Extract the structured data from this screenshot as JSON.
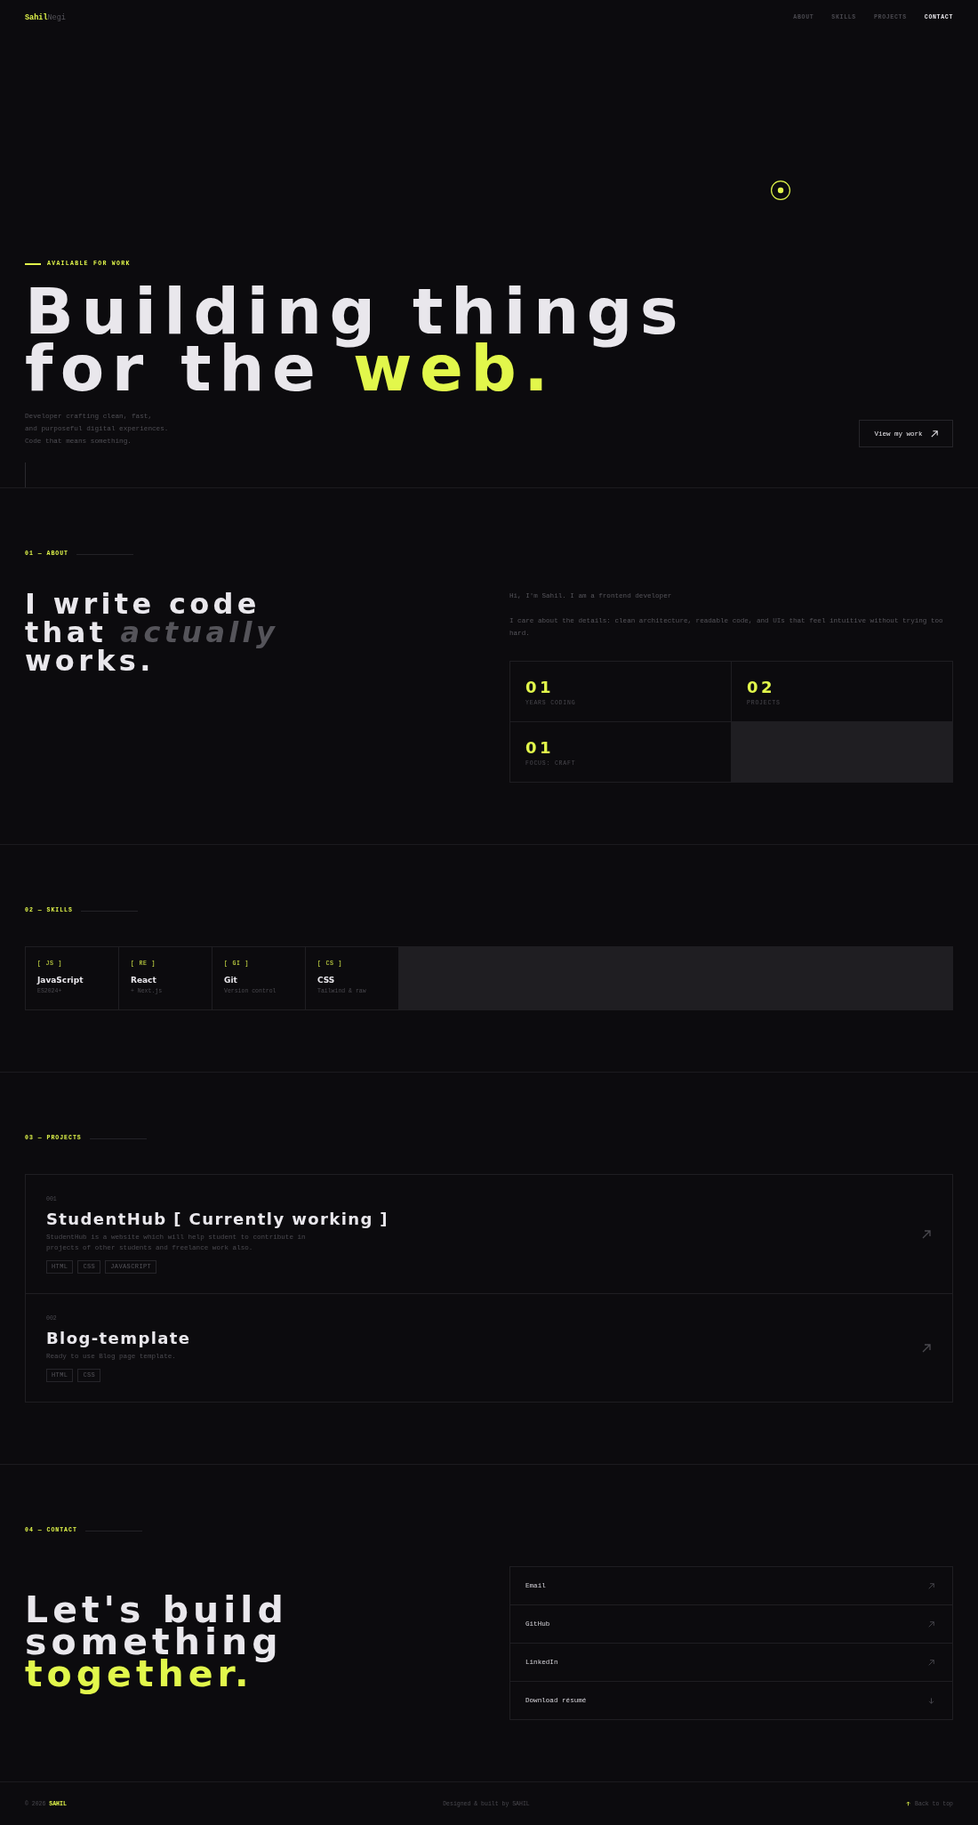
{
  "nav": {
    "logo": "**Sahil**Negi",
    "links": [
      {
        "label": "ABOUT",
        "selected": false
      },
      {
        "label": "SKILLS",
        "selected": false
      },
      {
        "label": "PROJECTS",
        "selected": false
      },
      {
        "label": "CONTACT",
        "selected": true
      }
    ]
  },
  "hero": {
    "status": "AVAILABLE FOR WORK",
    "title": "Building things\nfor the **web.**",
    "intro": "Developer crafting clean, fast,\nand purposeful digital experiences.\nCode that means something.",
    "cta": "View my work"
  },
  "about": {
    "section_label": "01 — ABOUT",
    "title": "I write code\nthat *actually*\nworks.",
    "paragraphs": [
      "Hi, I'm Sahil. I am a frontend developer",
      "I care about the details: clean architecture, readable code, and UIs that feel intuitive without trying too hard."
    ],
    "stats": [
      {
        "value": "01",
        "label": "YEARS CODING"
      },
      {
        "value": "02",
        "label": "PROJECTS"
      },
      {
        "value": "01",
        "label": "FOCUS: CRAFT"
      }
    ]
  },
  "skills": {
    "section_label": "02 — SKILLS",
    "items": [
      {
        "code": "[ JS ]",
        "name": "JavaScript",
        "detail": "ES2024+"
      },
      {
        "code": "[ RE ]",
        "name": "React",
        "detail": "+ Next.js"
      },
      {
        "code": "[ GI ]",
        "name": "Git",
        "detail": "Version control"
      },
      {
        "code": "[ CS ]",
        "name": "CSS",
        "detail": "Tailwind & raw"
      }
    ]
  },
  "projects": {
    "section_label": "03 — PROJECTS",
    "items": [
      {
        "number": "001",
        "title": "StudentHub [ Currently working ]",
        "description": "StudentHub is a website which will help student to contribute in projects of other students and freelance work also.",
        "tags": [
          "HTML",
          "CSS",
          "JAVASCRIPT"
        ]
      },
      {
        "number": "002",
        "title": "Blog-template",
        "description": "Ready to use Blog page template.",
        "tags": [
          "HTML",
          "CSS"
        ]
      }
    ]
  },
  "contact": {
    "section_label": "04 — CONTACT",
    "title": "Let's build\nsomething\n**together.**",
    "links": [
      {
        "label": "Email",
        "kind": "external"
      },
      {
        "label": "GitHub",
        "kind": "external"
      },
      {
        "label": "LinkedIn",
        "kind": "external"
      },
      {
        "label": "Download résumé",
        "kind": "download"
      }
    ]
  },
  "footer": {
    "copyright": "© 2026 **SAHIL**",
    "credit": "Designed & built by SAHIL",
    "back_to_top": "Back to top"
  }
}
